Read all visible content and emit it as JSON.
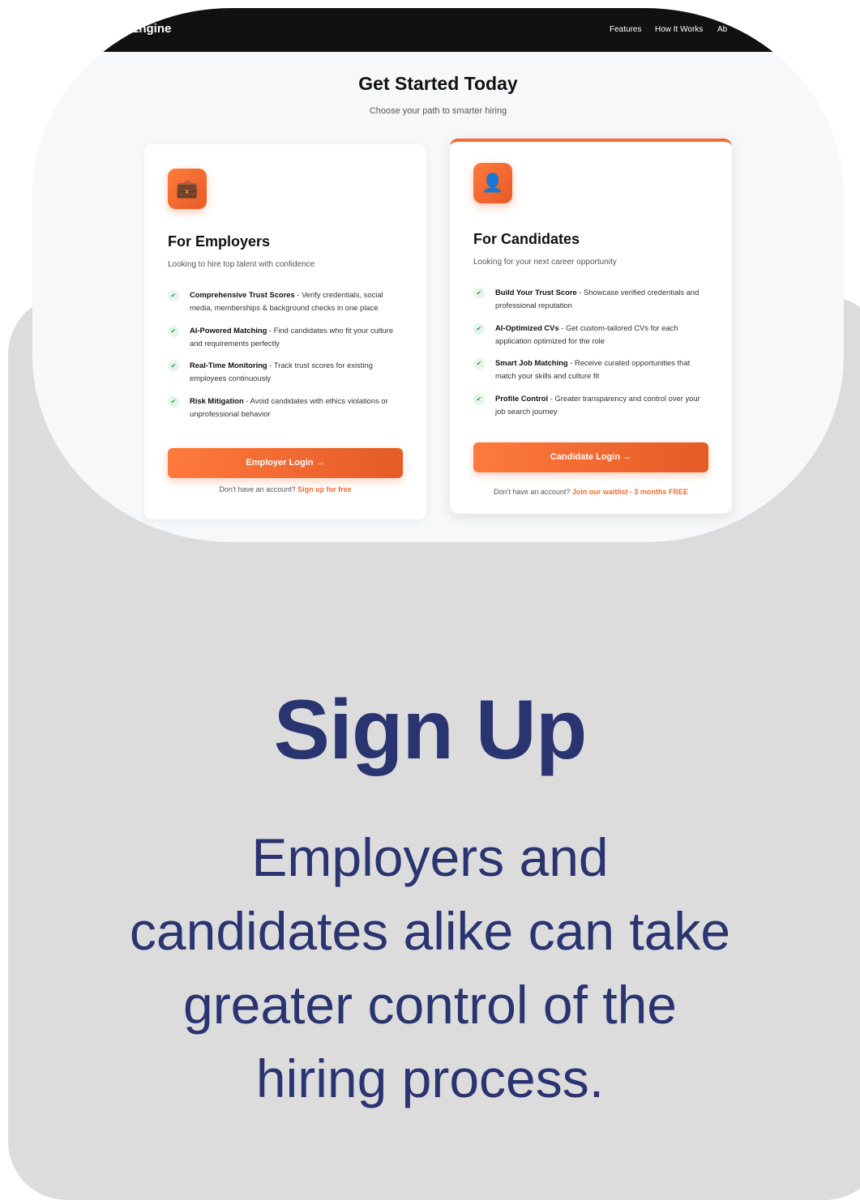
{
  "nav": {
    "logo": "Hire Engine",
    "links": [
      "Features",
      "How It Works",
      "Ab"
    ]
  },
  "hero": {
    "title": "Get Started Today",
    "subtitle": "Choose your path to smarter hiring"
  },
  "employers": {
    "icon": "briefcase-icon",
    "title": "For Employers",
    "subtitle": "Looking to hire top talent with confidence",
    "features": [
      {
        "bold": "Comprehensive Trust Scores",
        "text": " - Verify credentials, social media, memberships & background checks in one place"
      },
      {
        "bold": "AI-Powered Matching",
        "text": " - Find candidates who fit your culture and requirements perfectly"
      },
      {
        "bold": "Real-Time Monitoring",
        "text": " - Track trust scores for existing employees continuously"
      },
      {
        "bold": "Risk Mitigation",
        "text": " - Avoid candidates with ethics violations or unprofessional behavior"
      }
    ],
    "button": "Employer Login →",
    "footer_text": "Don't have an account? ",
    "footer_link": "Sign up for free"
  },
  "candidates": {
    "icon": "person-icon",
    "title": "For Candidates",
    "subtitle": "Looking for your next career opportunity",
    "features": [
      {
        "bold": "Build Your Trust Score",
        "text": " - Showcase verified credentials and professional reputation"
      },
      {
        "bold": "AI-Optimized CVs",
        "text": " - Get custom-tailored CVs for each application optimized for the role"
      },
      {
        "bold": "Smart Job Matching",
        "text": " - Receive curated opportunities that match your skills and culture fit"
      },
      {
        "bold": "Profile Control",
        "text": " - Greater transparency and control over your job search journey"
      }
    ],
    "button": "Candidate Login →",
    "footer_text": "Don't have an account? ",
    "footer_link": "Join our waitlist - 3 months FREE"
  },
  "headline": "Sign Up",
  "description": "Employers and candidates alike can take greater control of the hiring process.",
  "colors": {
    "accent": "#f26b30",
    "navy": "#2a3470",
    "panel": "#dcdcdd"
  }
}
